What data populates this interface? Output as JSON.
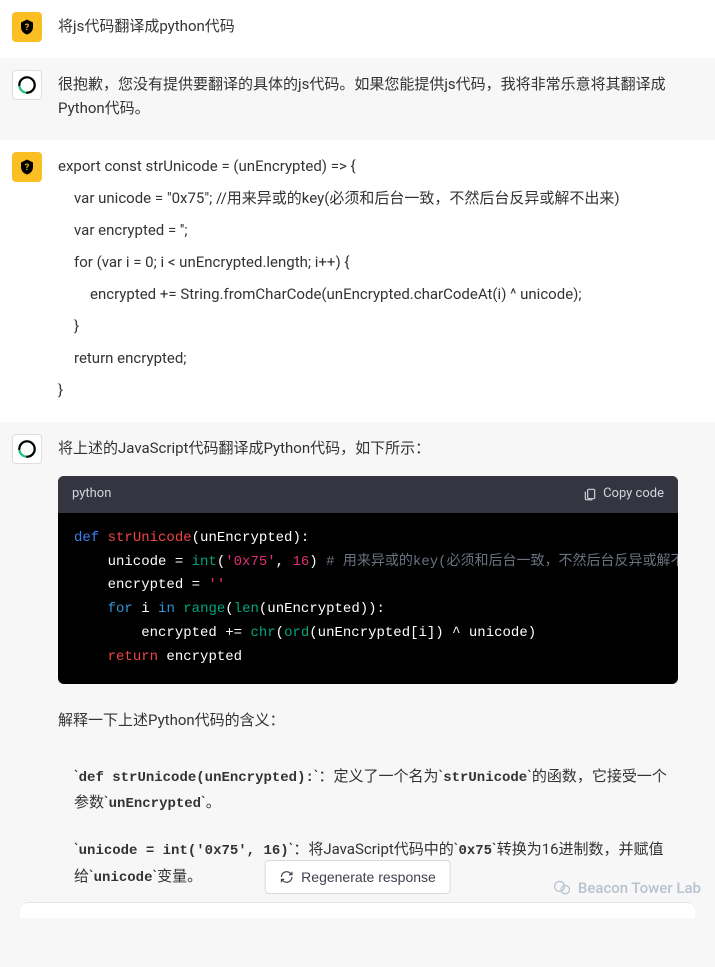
{
  "messages": {
    "m1_user": "将js代码翻译成python代码",
    "m2_assistant": "很抱歉，您没有提供要翻译的具体的js代码。如果您能提供js代码，我将非常乐意将其翻译成Python代码。",
    "m3_user": {
      "l1": "export const strUnicode = (unEncrypted) => {",
      "l2": "var unicode = \"0x75\"; //用来异或的key(必须和后台一致，不然后台反异或解不出来)",
      "l3": "var encrypted = '';",
      "l4": "for (var i = 0; i < unEncrypted.length; i++) {",
      "l5": "encrypted += String.fromCharCode(unEncrypted.charCodeAt(i) ^ unicode);",
      "l6": "}",
      "l7": "return encrypted;",
      "l8": "}"
    },
    "m4_intro": "将上述的JavaScript代码翻译成Python代码，如下所示：",
    "code": {
      "lang": "python",
      "copy_label": "Copy code",
      "tokens": {
        "def": "def",
        "fn": "strUnicode",
        "sig": "(unEncrypted):",
        "line2a": "    unicode = ",
        "int": "int",
        "lp": "(",
        "str": "'0x75'",
        "comma": ", ",
        "num": "16",
        "rp_end": ") ",
        "cmt": "# 用来异或的key(必须和后台一致，不然后台反异或解不出来",
        "line3a": "    encrypted = ",
        "empty": "''",
        "line4a": "    ",
        "for": "for",
        "line4b": " i ",
        "in": "in",
        "space": " ",
        "range": "range",
        "lp2": "(",
        "len": "len",
        "line4c": "(unEncrypted)):",
        "line5a": "        encrypted += ",
        "chr": "chr",
        "lp3": "(",
        "ord": "ord",
        "line5b": "(unEncrypted[i]) ^ unicode)",
        "line6a": "    ",
        "return": "return",
        "line6b": " encrypted"
      }
    },
    "m4_explain_title": "解释一下上述Python代码的含义：",
    "explain": {
      "e1_code": "def strUnicode(unEncrypted):",
      "e1_text_a": "：定义了一个名为",
      "e1_code2": "strUnicode",
      "e1_text_b": "的函数，它接受一个参数",
      "e1_code3": "unEncrypted",
      "e1_text_c": "。",
      "e2_code": "unicode = int('0x75', 16)",
      "e2_text_a": "：将JavaScript代码中的",
      "e2_code2": "0x75",
      "e2_text_b": "转换为16进制数，并赋值给",
      "e2_code3": "unicode",
      "e2_text_c": "变量。"
    }
  },
  "regen_label": "Regenerate response",
  "watermark": "Beacon Tower Lab"
}
